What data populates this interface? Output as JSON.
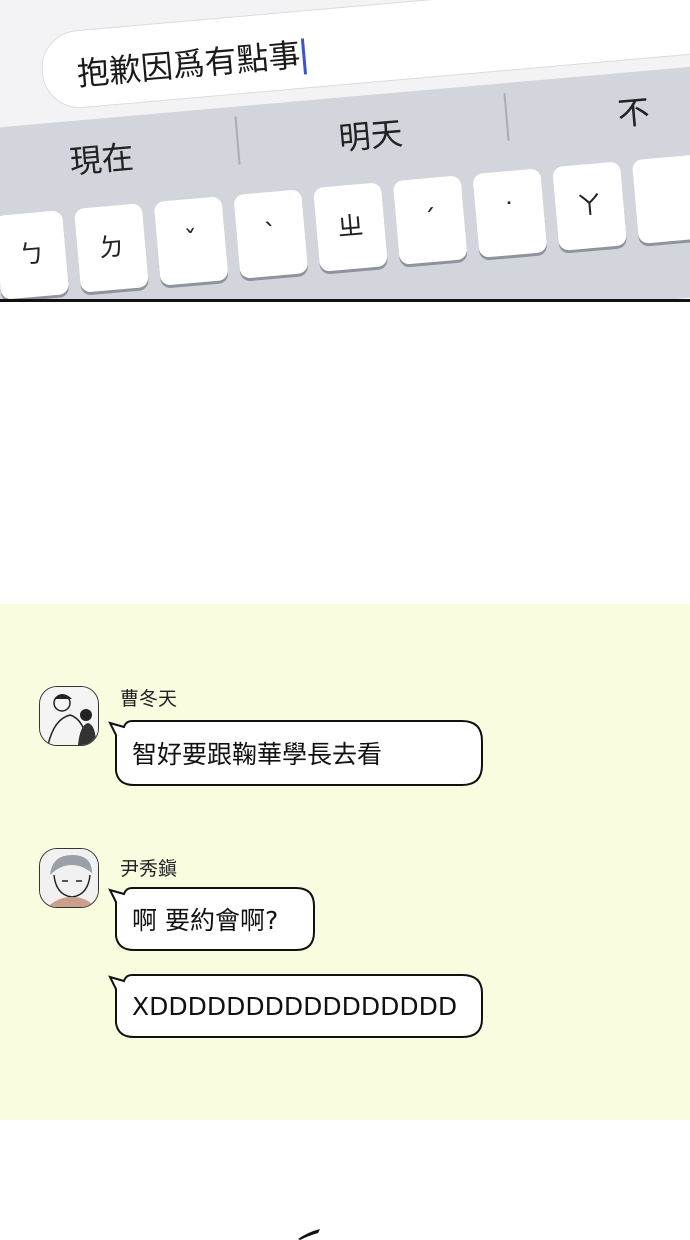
{
  "keyboard": {
    "typed_text": "抱歉因爲有點事",
    "suggestions": [
      "現在",
      "明天",
      "不"
    ],
    "keys": [
      "ㄅ",
      "ㄉ",
      "ˇ",
      "ˋ",
      "ㄓ",
      "ˊ",
      "˙",
      "ㄚ"
    ],
    "emoji_icon": "smiley-icon",
    "send_icon": "send-icon"
  },
  "chat": {
    "background": "#f9fcdf",
    "messages": [
      {
        "sender": "曹冬天",
        "bubbles": [
          "智好要跟鞠華學長去看"
        ]
      },
      {
        "sender": "尹秀鎭",
        "bubbles": [
          "啊 要約會啊?",
          "XDDDDDDDDDDDDDDDD"
        ]
      }
    ]
  }
}
